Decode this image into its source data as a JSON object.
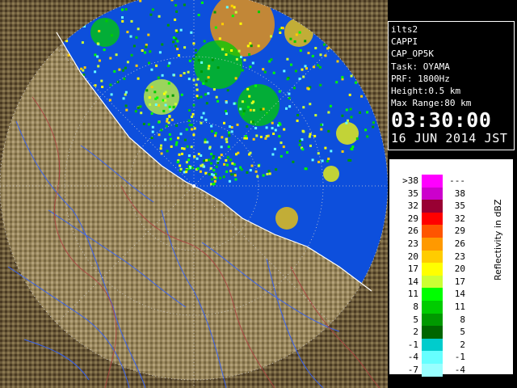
{
  "info_panel": {
    "radar_id": "ilts2",
    "product": "CAPPI",
    "scan_name": "CAP_OP5K",
    "task": "Task: OYAMA",
    "prf": "PRF: 1800Hz",
    "height": "Height:0.5 km",
    "max_range": "Max Range:80 km",
    "time": "03:30:00",
    "date": "16 JUN 2014 JST"
  },
  "legend": {
    "title": "Reflectivity in dBZ",
    "rows": [
      {
        "lo": ">38",
        "hi": "---",
        "color": "#ff00ff"
      },
      {
        "lo": "35",
        "hi": "38",
        "color": "#cc00cc"
      },
      {
        "lo": "32",
        "hi": "35",
        "color": "#990033"
      },
      {
        "lo": "29",
        "hi": "32",
        "color": "#ff0000"
      },
      {
        "lo": "26",
        "hi": "29",
        "color": "#ff5500"
      },
      {
        "lo": "23",
        "hi": "26",
        "color": "#ff9900"
      },
      {
        "lo": "20",
        "hi": "23",
        "color": "#ffcc00"
      },
      {
        "lo": "17",
        "hi": "20",
        "color": "#ffff00"
      },
      {
        "lo": "14",
        "hi": "17",
        "color": "#ccff33"
      },
      {
        "lo": "11",
        "hi": "14",
        "color": "#00ff00"
      },
      {
        "lo": "8",
        "hi": "11",
        "color": "#00cc00"
      },
      {
        "lo": "5",
        "hi": "8",
        "color": "#009900"
      },
      {
        "lo": "2",
        "hi": "5",
        "color": "#006600"
      },
      {
        "lo": "-1",
        "hi": "2",
        "color": "#00cccc"
      },
      {
        "lo": "-4",
        "hi": "-1",
        "color": "#66ffff"
      },
      {
        "lo": "-7",
        "hi": "-4",
        "color": "#99ffff"
      }
    ]
  },
  "colors": {
    "sea": "#0d4fdc",
    "terrain_dark": "#3a2a18",
    "terrain_mid": "#7a6a44",
    "terrain_light": "#b4a37c",
    "rivers": "#3060ff",
    "boundaries": "#b04040"
  }
}
